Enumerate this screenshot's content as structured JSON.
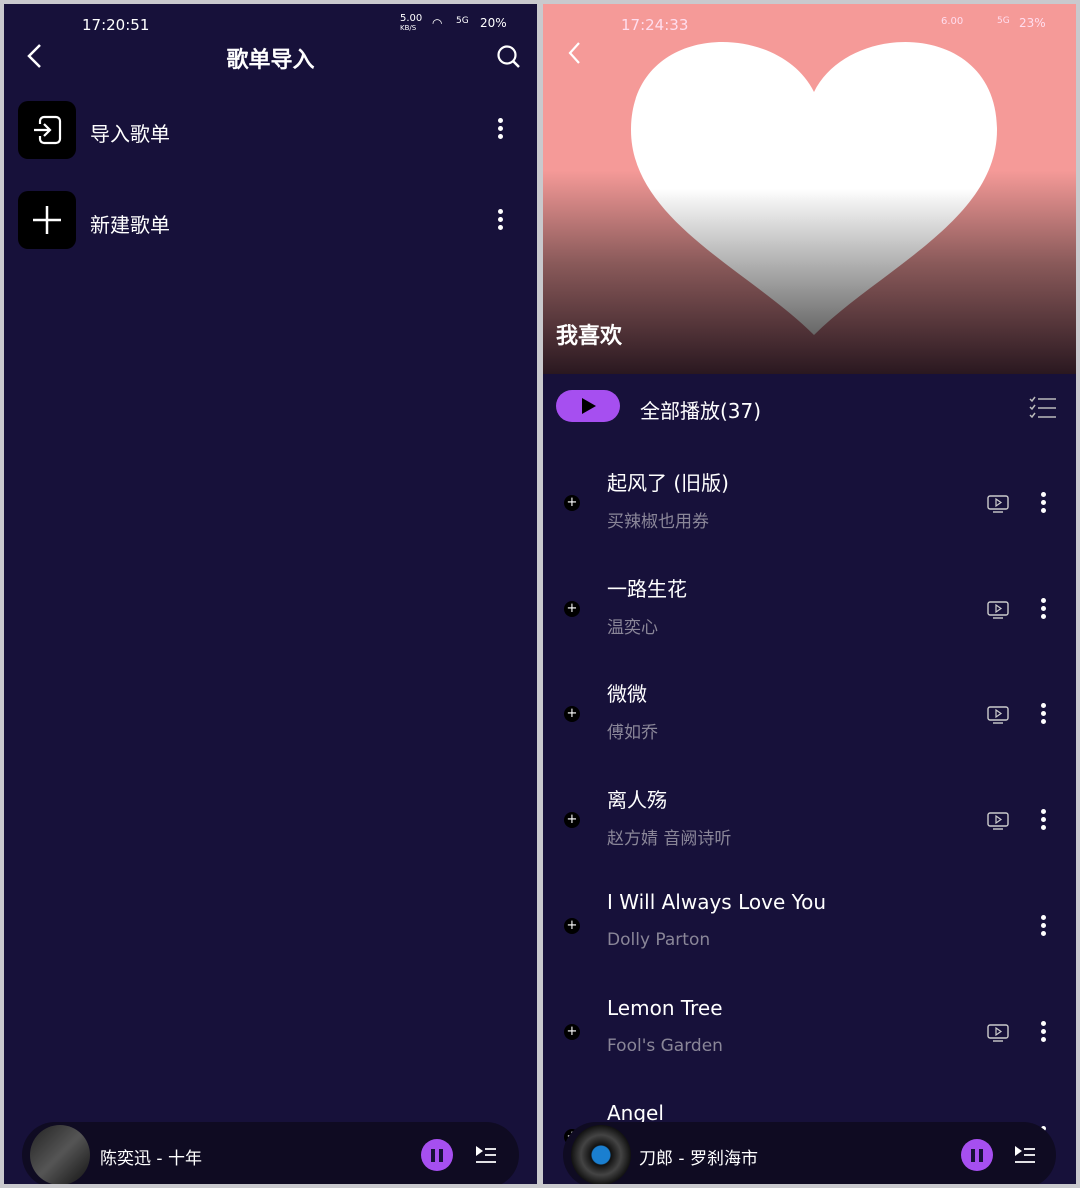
{
  "left": {
    "status": {
      "time": "17:20:51",
      "speed": "5.00",
      "speed_unit": "KB/S",
      "network": "5G",
      "battery": "20%"
    },
    "header": {
      "title": "歌单导入"
    },
    "items": [
      {
        "label": "导入歌单",
        "icon": "import-icon"
      },
      {
        "label": "新建歌单",
        "icon": "plus-icon"
      }
    ],
    "mini_player": {
      "track": "陈奕迅 - 十年"
    }
  },
  "right": {
    "status": {
      "time": "17:24:33",
      "speed": "6.00",
      "network": "5G",
      "battery": "23%"
    },
    "playlist": {
      "title": "我喜欢",
      "cover_color": "#f59a98"
    },
    "play_all": {
      "label": "全部播放(37)"
    },
    "songs": [
      {
        "title": "起风了 (旧版)",
        "artist": "买辣椒也用券",
        "mv": true
      },
      {
        "title": "一路生花",
        "artist": "温奕心",
        "mv": true
      },
      {
        "title": "微微",
        "artist": "傅如乔",
        "mv": true
      },
      {
        "title": "离人殇",
        "artist": "赵方婧 音阙诗听",
        "mv": true
      },
      {
        "title": "I Will Always Love You",
        "artist": "Dolly Parton",
        "mv": false
      },
      {
        "title": "Lemon Tree",
        "artist": "Fool's Garden",
        "mv": true
      },
      {
        "title": "Angel",
        "artist": "",
        "mv": true
      }
    ],
    "mini_player": {
      "track": "刀郎 - 罗刹海市"
    }
  },
  "colors": {
    "background": "#17113a",
    "accent": "#a64ff0"
  }
}
